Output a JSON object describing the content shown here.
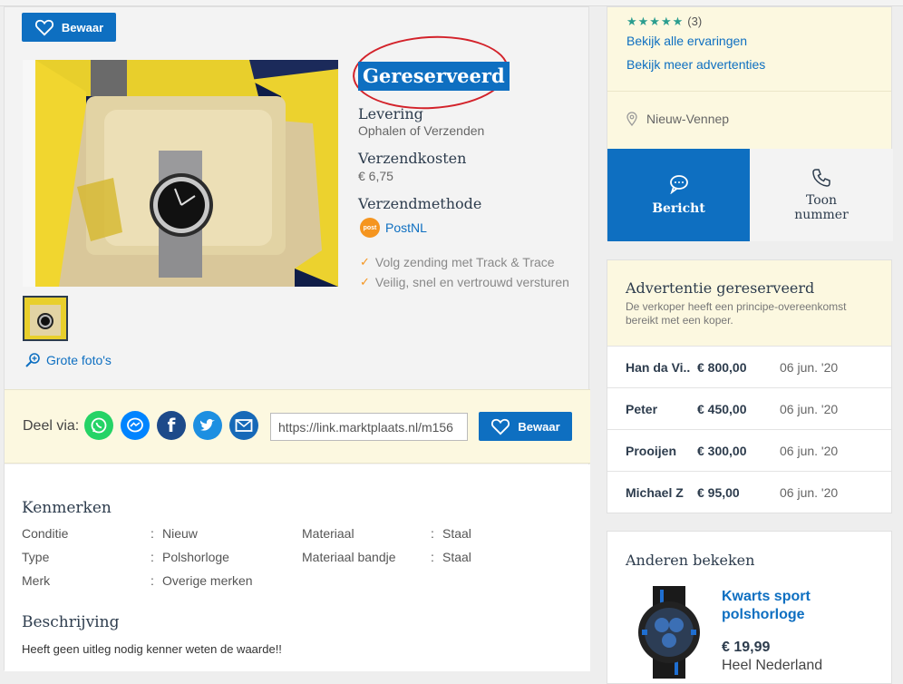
{
  "save_button_label": "Bewaar",
  "status": "Gereserveerd",
  "delivery": {
    "title": "Levering",
    "value": "Ophalen of Verzenden",
    "cost_title": "Verzendkosten",
    "cost_value": "€ 6,75",
    "method_title": "Verzendmethode",
    "method_value": "PostNL",
    "features": [
      "Volg zending met Track & Trace",
      "Veilig, snel en vertrouwd versturen"
    ]
  },
  "photos_link": "Grote foto's",
  "share": {
    "label": "Deel via:",
    "link": "https://link.marktplaats.nl/m156",
    "save_label": "Bewaar",
    "icons": [
      "whatsapp-icon",
      "messenger-icon",
      "facebook-icon",
      "twitter-icon",
      "email-icon"
    ]
  },
  "kenmerken": {
    "title": "Kenmerken",
    "rows": [
      {
        "k1": "Conditie",
        "v1": "Nieuw",
        "k2": "Materiaal",
        "v2": "Staal"
      },
      {
        "k1": "Type",
        "v1": "Polshorloge",
        "k2": "Materiaal bandje",
        "v2": "Staal"
      },
      {
        "k1": "Merk",
        "v1": "Overige merken",
        "k2": "",
        "v2": ""
      }
    ],
    "separator": ":"
  },
  "description": {
    "title": "Beschrijving",
    "text": "Heeft geen uitleg nodig kenner weten de waarde!!"
  },
  "seller": {
    "stars": "★★★★★",
    "review_count": "(3)",
    "link_reviews": "Bekijk alle ervaringen",
    "link_ads": "Bekijk meer advertenties",
    "location": "Nieuw-Vennep",
    "message_label": "Bericht",
    "phone_label_line1": "Toon",
    "phone_label_line2": "nummer"
  },
  "bids": {
    "title": "Advertentie gereserveerd",
    "subtitle_line1": "De verkoper heeft een principe-overeenkomst",
    "subtitle_line2": "bereikt met een koper.",
    "rows": [
      {
        "name": "Han da Vi...",
        "amount": "€ 800,00",
        "date": "06 jun. '20"
      },
      {
        "name": "Peter",
        "amount": "€ 450,00",
        "date": "06 jun. '20"
      },
      {
        "name": "Prooijen",
        "amount": "€ 300,00",
        "date": "06 jun. '20"
      },
      {
        "name": "Michael Z",
        "amount": "€ 95,00",
        "date": "06 jun. '20"
      }
    ]
  },
  "others": {
    "title": "Anderen bekeken",
    "item_title_line1": "Kwarts sport",
    "item_title_line2": "polshorloge",
    "item_price": "€ 19,99",
    "item_location": "Heel Nederland"
  },
  "colors": {
    "brand_blue": "#0e6fc1",
    "yellow_bg": "#fcf8e0",
    "rating_green": "#2a9d8f"
  }
}
